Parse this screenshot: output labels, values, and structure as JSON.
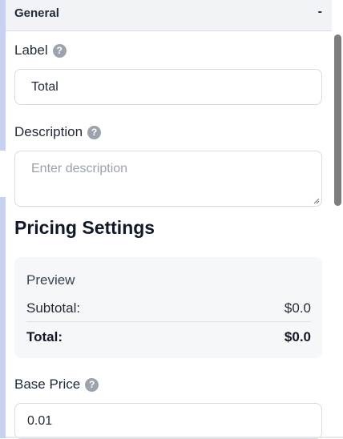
{
  "section": {
    "title": "General",
    "toggle": "-"
  },
  "label_field": {
    "label": "Label",
    "value": "Total"
  },
  "description_field": {
    "label": "Description",
    "placeholder": "Enter description"
  },
  "pricing": {
    "heading": "Pricing Settings",
    "preview": {
      "title": "Preview",
      "subtotal_label": "Subtotal:",
      "subtotal_value": "$0.0",
      "total_label": "Total:",
      "total_value": "$0.0"
    }
  },
  "base_price_field": {
    "label": "Base Price",
    "value": "0.01"
  },
  "help_icon_glyph": "?",
  "colors": {
    "accent_strip": "#c7d2f0",
    "header_bg": "#f2f3f6",
    "help_icon": "#9ca3af",
    "card_bg": "#f6f7f9"
  }
}
